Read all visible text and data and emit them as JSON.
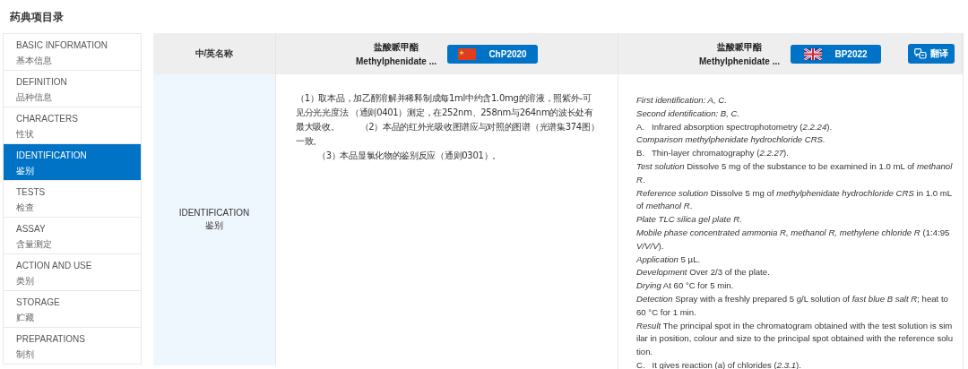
{
  "page_title": "药典项目录",
  "sidebar": {
    "items": [
      {
        "en": "BASIC INFORMATION",
        "zh": "基本信息",
        "selected": false
      },
      {
        "en": "DEFINITION",
        "zh": "品种信息",
        "selected": false
      },
      {
        "en": "CHARACTERS",
        "zh": "性状",
        "selected": false
      },
      {
        "en": "IDENTIFICATION",
        "zh": "鉴别",
        "selected": true
      },
      {
        "en": "TESTS",
        "zh": "检查",
        "selected": false
      },
      {
        "en": "ASSAY",
        "zh": "含量测定",
        "selected": false
      },
      {
        "en": "ACTION AND USE",
        "zh": "类别",
        "selected": false
      },
      {
        "en": "STORAGE",
        "zh": "贮藏",
        "selected": false
      },
      {
        "en": "PREPARATIONS",
        "zh": "制剂",
        "selected": false
      }
    ]
  },
  "table": {
    "columns": [
      {
        "kind": "label",
        "title": "中/英名称"
      },
      {
        "kind": "edition",
        "name_zh": "盐酸哌甲酯",
        "name_en": "Methylphenidate ...",
        "edition": "ChP2020",
        "flag": {
          "kind": "china"
        }
      },
      {
        "kind": "edition",
        "name_zh": "盐酸哌甲酯",
        "name_en": "Methylphenidate ...",
        "edition": "BP2022",
        "flag": {
          "kind": "uk"
        },
        "translate_label": "翻译"
      }
    ],
    "row": {
      "label_en": "IDENTIFICATION",
      "label_zh": "鉴别",
      "chp_paragraphs": [
        "（1）取本品，加乙醇溶解并稀释制成每1ml中约含1.0mg的溶液，照紫外-可见分光光度法 （通则0401）测定，在252nm、258nm与264nm的波长处有最大吸收。        （2）本品的红外光吸收图谱应与对照的图谱（光谱集374图）一致。",
        "（3）本品显氯化物的鉴别反应（通则0301）。"
      ],
      "bp_lines": [
        {
          "text": "First identification: A, C.",
          "italic": true
        },
        {
          "text": "Second identification: B, C.",
          "italic": true
        },
        {
          "text": "A.   Infrared absorption spectrophotometry (*2.2.24*).",
          "italic": false
        },
        {
          "text": "Comparison methylphenidate hydrochloride CRS.",
          "italic": true
        },
        {
          "text": "B.   Thin-layer chromatography (*2.2.27*).",
          "italic": false
        },
        {
          "text": "*Test solution* Dissolve 5 mg of the substance to be examined in 1.0 mL of *methanol R*.",
          "italic": false
        },
        {
          "text": "*Reference solution* Dissolve 5 mg of *methylphenidate hydrochloride CRS* in 1.0 mL of *methanol R*.",
          "italic": false
        },
        {
          "text": "Plate TLC silica gel plate R.",
          "italic": true
        },
        {
          "text": "*Mobile phase concentrated ammonia R, methanol R, methylene chloride R* (1:4:95 *V/V/V*).",
          "italic": false
        },
        {
          "text": "*Application* 5 µL.",
          "italic": false
        },
        {
          "text": "*Development* Over 2/3 of the plate.",
          "italic": false
        },
        {
          "text": "*Drying* At 60 °C for 5 min.",
          "italic": false
        },
        {
          "text": "*Detection* Spray with a freshly prepared 5 g/L solution of *fast blue B salt R*; heat to 60 °C for 1 min.",
          "italic": false
        },
        {
          "text": "*Result* The principal spot in the chromatogram obtained with the test solution is similar in position, colour and size to the principal spot obtained with the reference solution.",
          "italic": false
        },
        {
          "text": "C.   It gives reaction (a) of chlorides (*2.3.1*).",
          "italic": false
        }
      ]
    }
  }
}
